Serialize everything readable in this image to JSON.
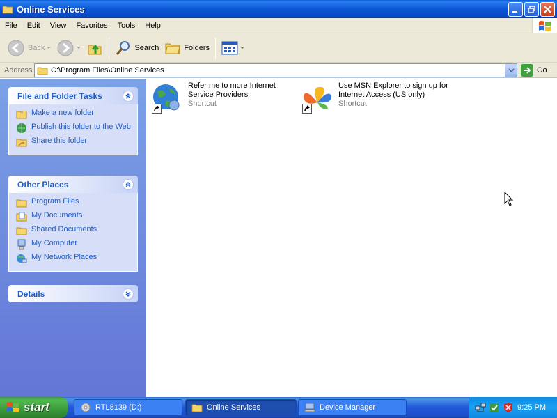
{
  "window": {
    "title": "Online Services"
  },
  "menu": [
    "File",
    "Edit",
    "View",
    "Favorites",
    "Tools",
    "Help"
  ],
  "toolbar": {
    "back_label": "Back",
    "search_label": "Search",
    "folders_label": "Folders"
  },
  "address": {
    "label": "Address",
    "value": "C:\\Program Files\\Online Services",
    "go_label": "Go"
  },
  "sidebar": {
    "file_tasks": {
      "title": "File and Folder Tasks",
      "items": [
        {
          "label": "Make a new folder",
          "icon": "new-folder-icon"
        },
        {
          "label": "Publish this folder to the Web",
          "icon": "publish-web-icon"
        },
        {
          "label": "Share this folder",
          "icon": "share-folder-icon"
        }
      ]
    },
    "other_places": {
      "title": "Other Places",
      "items": [
        {
          "label": "Program Files",
          "icon": "folder-icon"
        },
        {
          "label": "My Documents",
          "icon": "my-documents-icon"
        },
        {
          "label": "Shared Documents",
          "icon": "folder-icon"
        },
        {
          "label": "My Computer",
          "icon": "my-computer-icon"
        },
        {
          "label": "My Network Places",
          "icon": "network-places-icon"
        }
      ]
    },
    "details": {
      "title": "Details"
    }
  },
  "files": [
    {
      "name": "Refer me to more Internet Service Providers",
      "type": "Shortcut",
      "icon": "internet-globe-icon"
    },
    {
      "name": "Use MSN Explorer to sign up for Internet Access (US only)",
      "type": "Shortcut",
      "icon": "msn-butterfly-icon"
    }
  ],
  "taskbar": {
    "start_label": "start",
    "buttons": [
      {
        "label": "RTL8139 (D:)",
        "icon": "cd-drive-icon"
      },
      {
        "label": "Online Services",
        "icon": "folder-icon"
      },
      {
        "label": "Device Manager",
        "icon": "device-manager-icon"
      }
    ],
    "clock": "9:25 PM"
  },
  "colors": {
    "titlebar": "#0b55d6",
    "sidebar_link": "#215dc6",
    "sidebar_bg": "#7ba2e7",
    "taskbar": "#2157d7",
    "start_green": "#3a9a3a"
  }
}
